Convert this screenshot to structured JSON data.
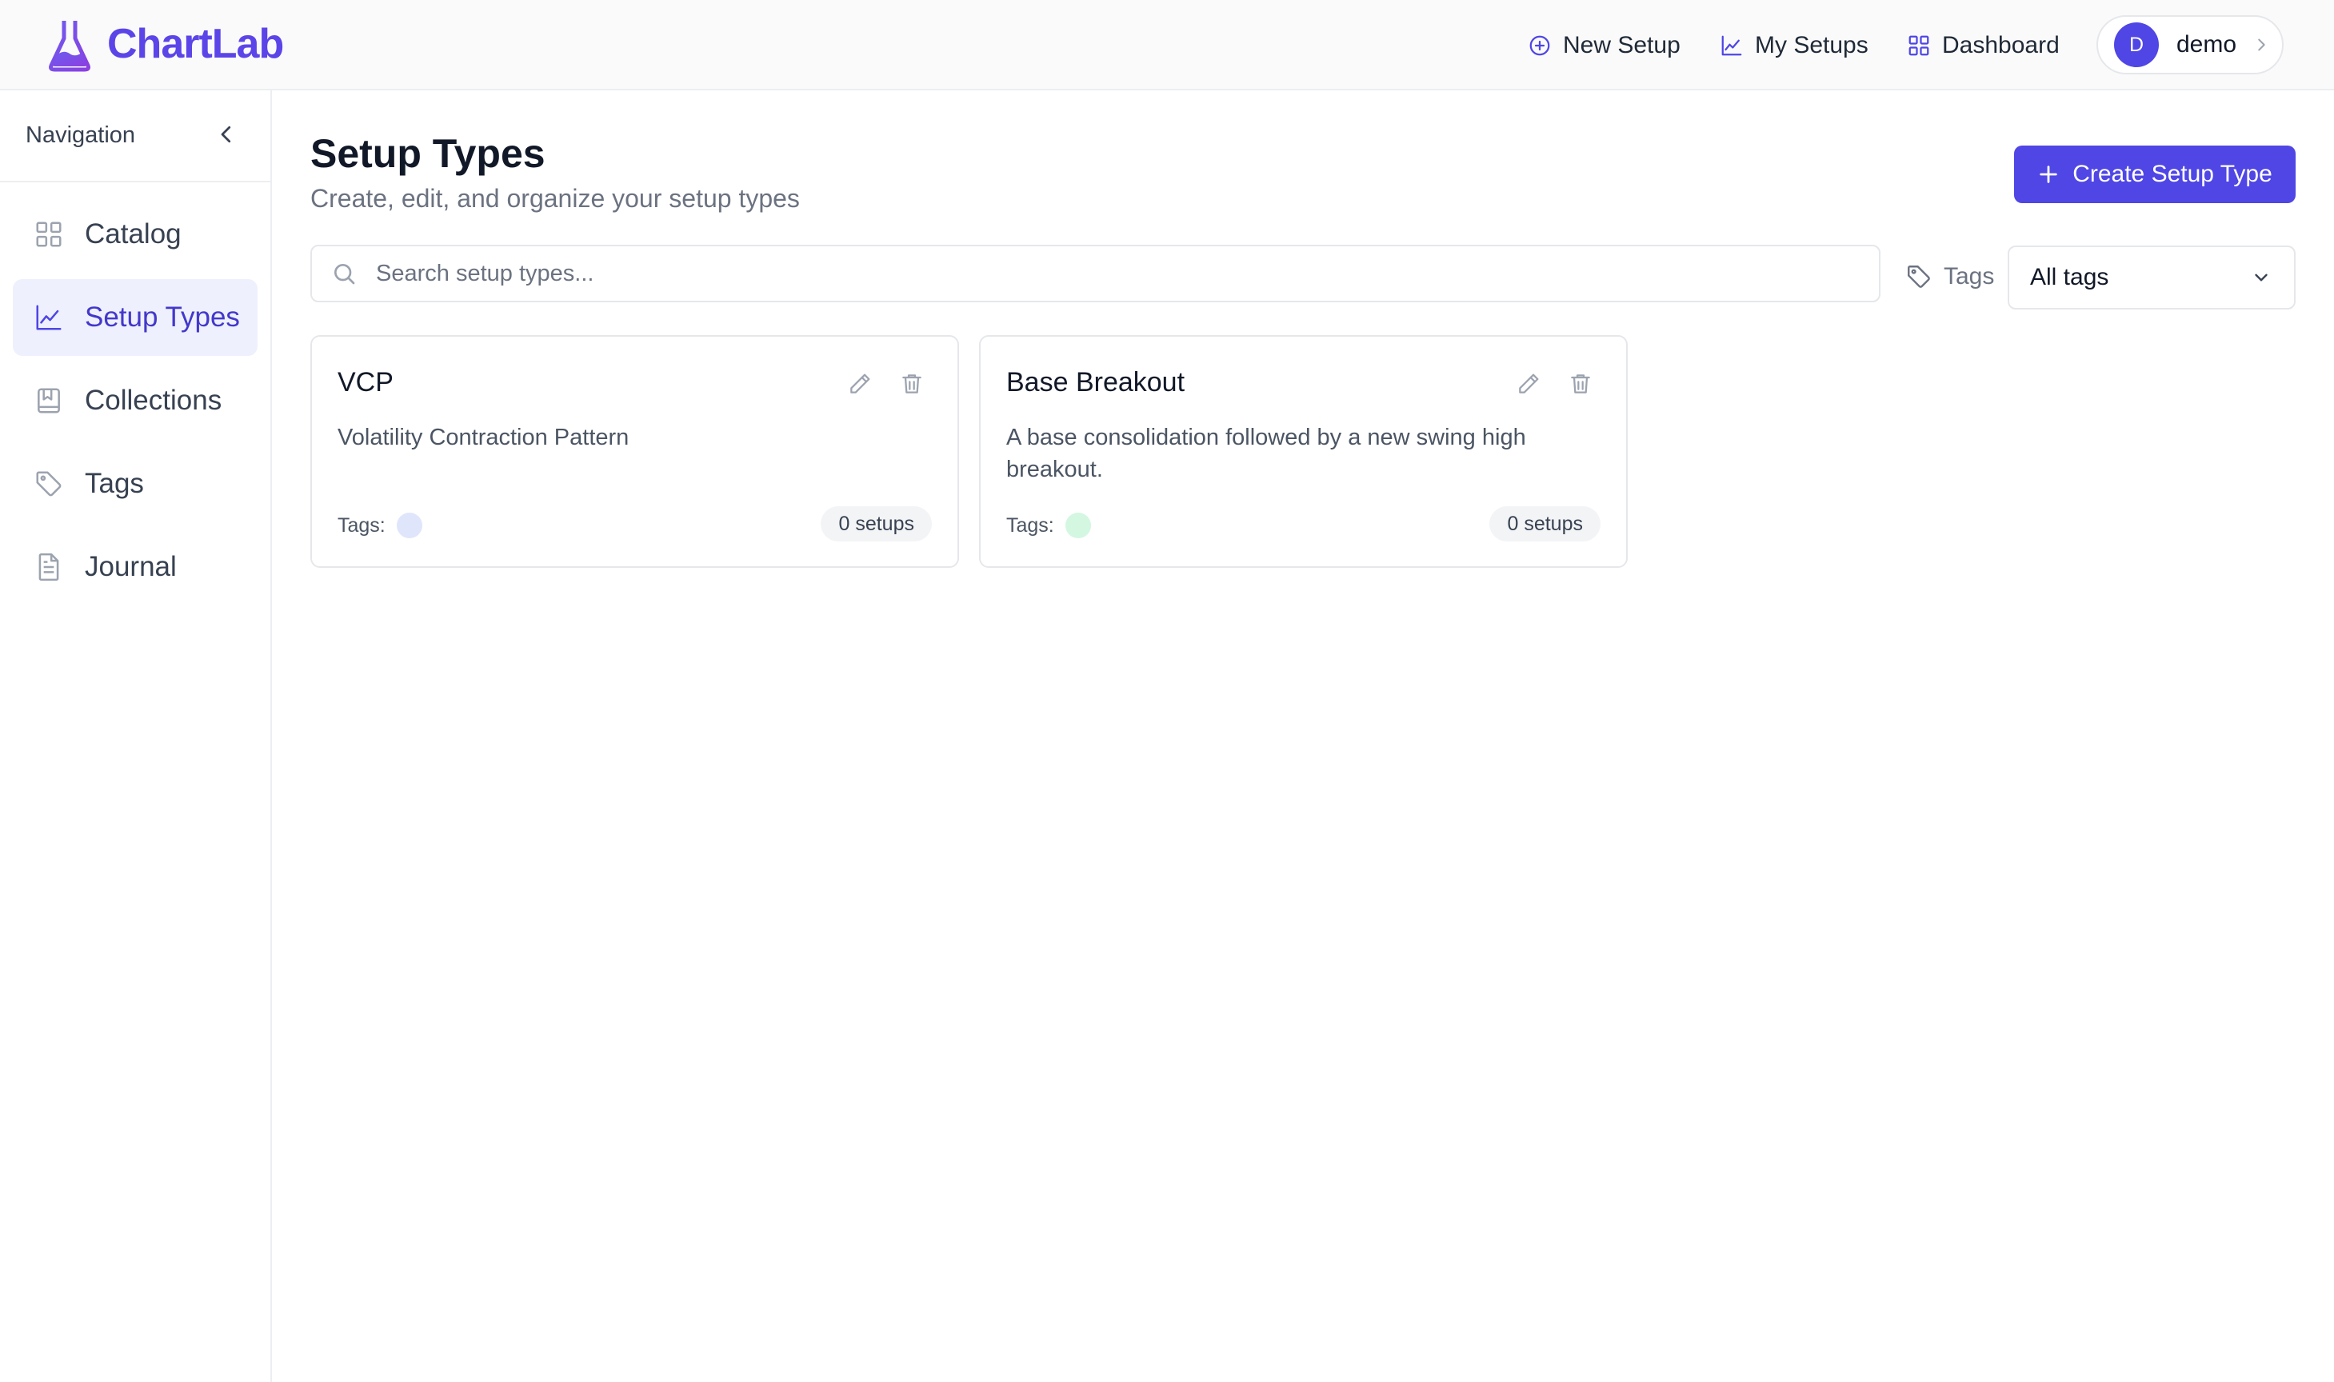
{
  "app": {
    "name": "ChartLab",
    "brand_color": "#5b45e8",
    "accent_color": "#4f46e5"
  },
  "header": {
    "nav": [
      {
        "label": "New Setup",
        "icon": "plus-circle-icon"
      },
      {
        "label": "My Setups",
        "icon": "line-chart-icon"
      },
      {
        "label": "Dashboard",
        "icon": "grid-icon"
      }
    ],
    "user": {
      "initial": "D",
      "name": "demo"
    }
  },
  "sidebar": {
    "title": "Navigation",
    "items": [
      {
        "label": "Catalog",
        "icon": "grid-icon",
        "active": false
      },
      {
        "label": "Setup Types",
        "icon": "line-chart-icon",
        "active": true
      },
      {
        "label": "Collections",
        "icon": "bookmark-book-icon",
        "active": false
      },
      {
        "label": "Tags",
        "icon": "tag-icon",
        "active": false
      },
      {
        "label": "Journal",
        "icon": "document-icon",
        "active": false
      }
    ]
  },
  "main": {
    "title": "Setup Types",
    "subtitle": "Create, edit, and organize your setup types",
    "create_button": "Create Setup Type",
    "search": {
      "placeholder": "Search setup types...",
      "value": ""
    },
    "tags_filter": {
      "label": "Tags",
      "selected": "All tags"
    },
    "cards": [
      {
        "title": "VCP",
        "description": "Volatility Contraction Pattern",
        "tags_label": "Tags:",
        "tag_color": "#dfe5fb",
        "count": "0 setups"
      },
      {
        "title": "Base Breakout",
        "description": "A base consolidation followed by a new swing high breakout.",
        "tags_label": "Tags:",
        "tag_color": "#d3f7e1",
        "count": "0 setups"
      }
    ]
  }
}
